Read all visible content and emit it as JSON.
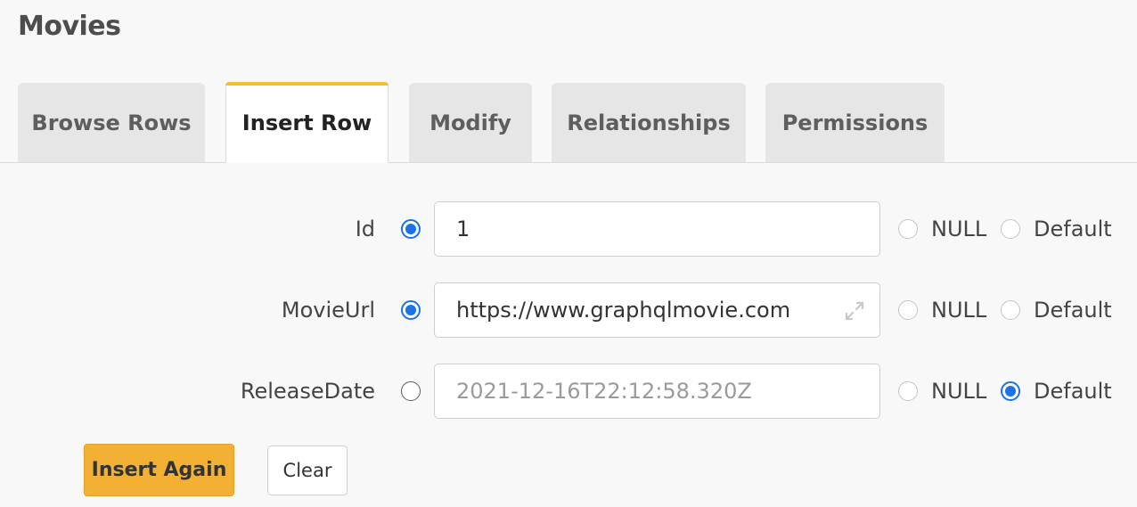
{
  "page": {
    "title": "Movies"
  },
  "tabs": [
    {
      "label": "Browse Rows",
      "active": false
    },
    {
      "label": "Insert Row",
      "active": true
    },
    {
      "label": "Modify",
      "active": false
    },
    {
      "label": "Relationships",
      "active": false
    },
    {
      "label": "Permissions",
      "active": false
    }
  ],
  "form": {
    "rows": [
      {
        "label": "Id",
        "value": "1",
        "placeholder": "",
        "selected": "value",
        "null_label": "NULL",
        "default_label": "Default"
      },
      {
        "label": "MovieUrl",
        "value": "https://www.graphqlmovie.com",
        "placeholder": "",
        "selected": "value",
        "null_label": "NULL",
        "default_label": "Default"
      },
      {
        "label": "ReleaseDate",
        "value": "",
        "placeholder": "2021-12-16T22:12:58.320Z",
        "selected": "default",
        "null_label": "NULL",
        "default_label": "Default"
      }
    ]
  },
  "actions": {
    "insert_again_label": "Insert Again",
    "clear_label": "Clear"
  },
  "colors": {
    "accent": "#f3c02e",
    "primary_button": "#f2b134",
    "radio_selected": "#1a73e8"
  },
  "icons": {
    "expand": "expand-arrows-icon"
  }
}
